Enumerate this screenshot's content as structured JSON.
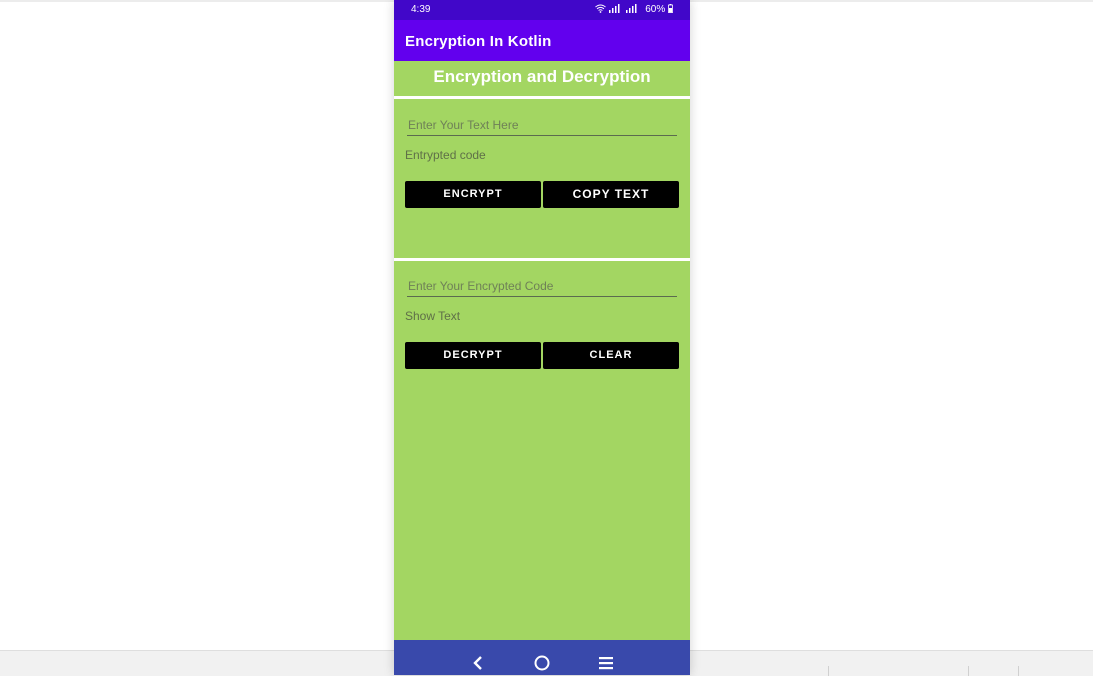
{
  "phone": {
    "status_time": "4:39",
    "status_battery": "60%",
    "app_title": "Encryption In Kotlin",
    "heading": "Encryption and Decryption",
    "encrypt_section": {
      "input_placeholder": "Enter Your Text Here",
      "output_label": "Entrypted code",
      "encrypt_button": "ENCRYPT",
      "copy_button": "COPY TEXT"
    },
    "decrypt_section": {
      "input_placeholder": "Enter Your Encrypted Code",
      "output_label": "Show Text",
      "decrypt_button": "DECRYPT",
      "clear_button": "CLEAR"
    }
  },
  "colors": {
    "app_bar": "#6200ee",
    "status_bar": "#4107c9",
    "background": "#a3d662",
    "nav_bar": "#3949ab",
    "button": "#000000"
  },
  "icons": [
    "wifi-icon",
    "signal-icon",
    "battery-icon",
    "back-nav-icon",
    "home-nav-icon",
    "recents-nav-icon"
  ]
}
